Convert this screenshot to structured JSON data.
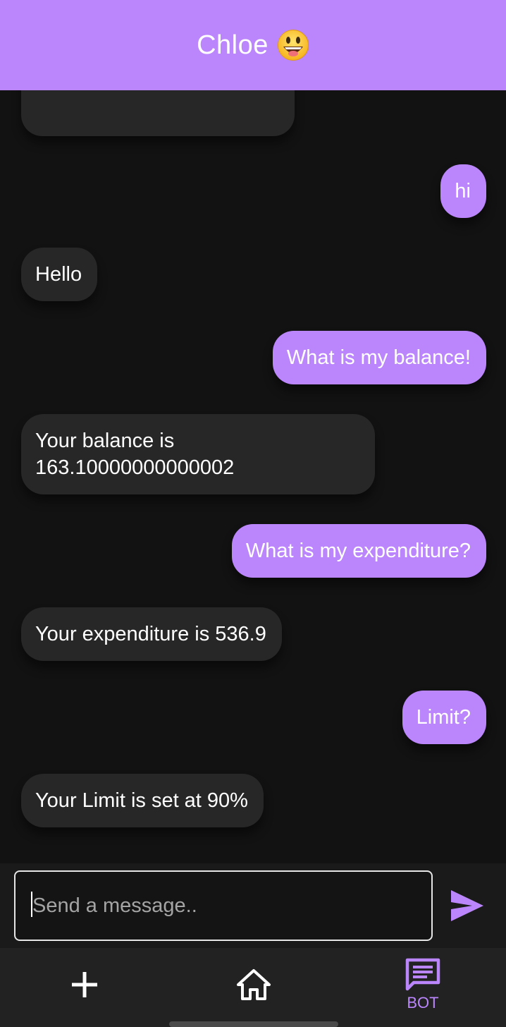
{
  "header": {
    "title": "Chloe",
    "emoji": "grinning-face-with-tongue"
  },
  "messages": [
    {
      "sender": "user",
      "text": "hi"
    },
    {
      "sender": "bot",
      "text": "Hello"
    },
    {
      "sender": "user",
      "text": "What is my balance!"
    },
    {
      "sender": "bot",
      "text": "Your balance is\n163.10000000000002"
    },
    {
      "sender": "user",
      "text": "What is my expenditure?"
    },
    {
      "sender": "bot",
      "text": "Your expenditure is 536.9"
    },
    {
      "sender": "user",
      "text": "Limit?"
    },
    {
      "sender": "bot",
      "text": "Your Limit is set at 90%"
    }
  ],
  "composer": {
    "placeholder": "Send a message..",
    "value": ""
  },
  "nav": {
    "items": [
      {
        "icon": "plus-icon",
        "label": ""
      },
      {
        "icon": "home-icon",
        "label": ""
      },
      {
        "icon": "chat-icon",
        "label": "BOT",
        "active": true
      }
    ]
  },
  "colors": {
    "accent": "#bb86fc",
    "background": "#121212",
    "bot_bubble": "#272727"
  }
}
